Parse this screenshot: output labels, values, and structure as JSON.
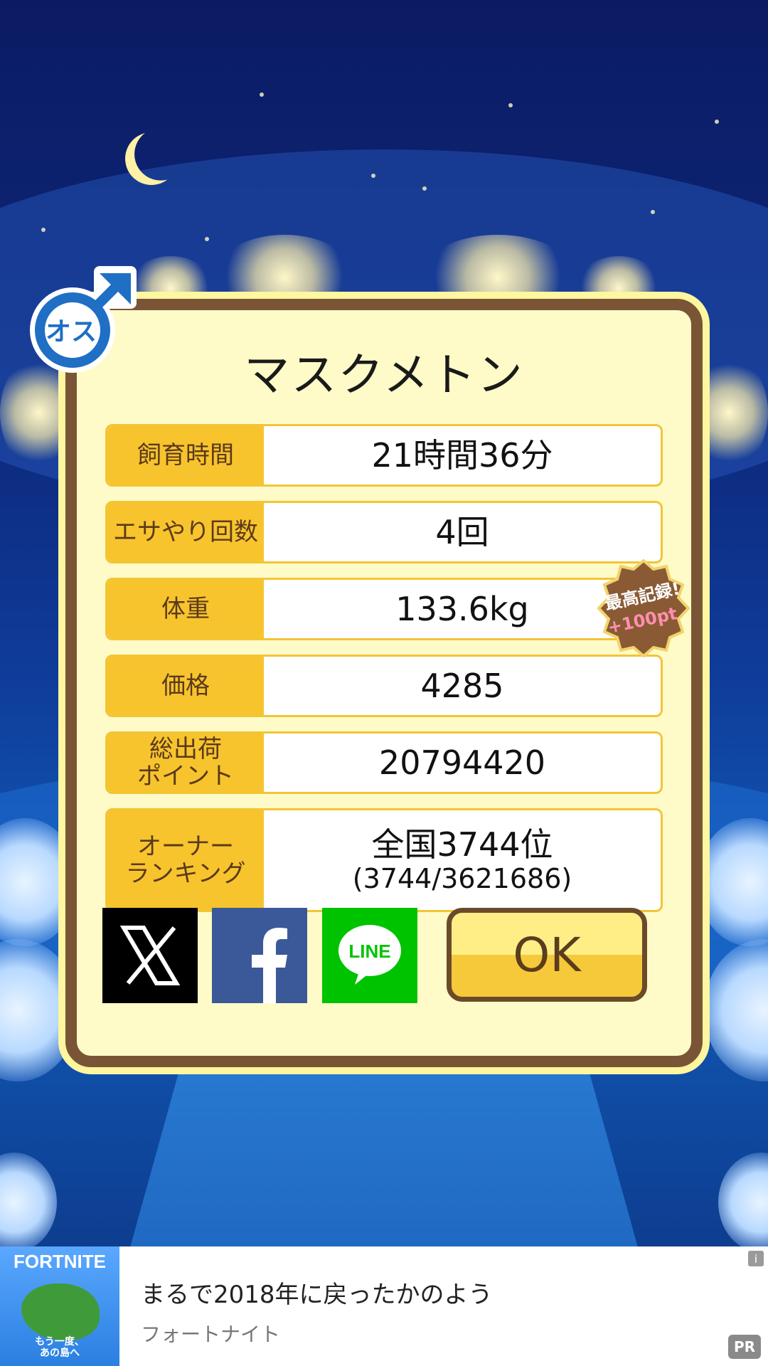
{
  "pet": {
    "gender_label": "オス",
    "name": "マスクメトン"
  },
  "stats": [
    {
      "label": "飼育時間",
      "value": "21時間36分"
    },
    {
      "label": "エサやり回数",
      "value": "4回"
    },
    {
      "label": "体重",
      "value": "133.6kg",
      "highlight": "#e8102a"
    },
    {
      "label": "価格",
      "value": "4285"
    },
    {
      "label": "総出荷\nポイント",
      "value": "20794420"
    },
    {
      "label": "オーナー\nランキング",
      "value": "全国3744位",
      "sub": "(3744/3621686)"
    }
  ],
  "record_badge": {
    "line1": "最高記録!",
    "line2": "+100pt"
  },
  "share": {
    "x_icon": "x-logo-icon",
    "facebook_icon": "facebook-logo-icon",
    "line_icon": "line-logo-icon",
    "line_text": "LINE"
  },
  "ok_button": "OK",
  "ad": {
    "thumb_title": "FORTNITE",
    "thumb_caption": "もう一度、\nあの島へ",
    "headline": "まるで2018年に戻ったかのよう",
    "advertiser": "フォートナイト",
    "pr_label": "PR",
    "info_label": "i"
  },
  "colors": {
    "accent": "#f7c42e",
    "frame": "#7a5535",
    "record_value": "#e8102a"
  }
}
